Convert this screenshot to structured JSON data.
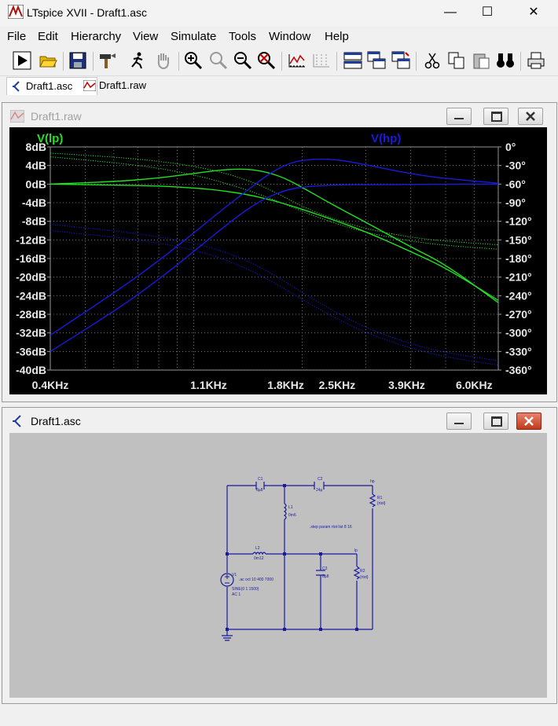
{
  "app": {
    "title": "LTspice XVII - Draft1.asc",
    "minimize": "—",
    "maximize": "☐",
    "close": "✕"
  },
  "menu": [
    "File",
    "Edit",
    "Hierarchy",
    "View",
    "Simulate",
    "Tools",
    "Window",
    "Help"
  ],
  "tabs": [
    {
      "label": "Draft1.asc",
      "icon": "schematic-icon",
      "active": true
    },
    {
      "label": "Draft1.raw",
      "icon": "waveform-icon",
      "active": false
    }
  ],
  "waveform_window": {
    "title": "Draft1.raw",
    "trace_labels": [
      {
        "name": "V(lp)",
        "color": "#22e022"
      },
      {
        "name": "V(hp)",
        "color": "#1a1adc"
      }
    ]
  },
  "schematic_window": {
    "title": "Draft1.asc",
    "components": {
      "C1": {
        "name": "C1",
        "value": "8µ8"
      },
      "C2": {
        "name": "C2",
        "value": "24µ"
      },
      "C3": {
        "name": "C3",
        "value": "8µ8"
      },
      "L1": {
        "name": "L1",
        "value": "0m6"
      },
      "L2": {
        "name": "L2",
        "value": "0m12"
      },
      "R1": {
        "name": "R1",
        "value": "{rtot}"
      },
      "R2": {
        "name": "R2",
        "value": "{rtot}"
      },
      "V1": {
        "name": "V1",
        "line2": "SINE(0 1 1500)",
        "line3": "AC 1"
      }
    },
    "net_labels": {
      "hp": "hp",
      "lp": "lp"
    },
    "directives": {
      "ac": ".ac oct 10 400 7000",
      "step": ".step param rtot list 8 16"
    }
  },
  "chart_data": {
    "type": "line",
    "title": "",
    "xlabel": "",
    "ylabel": "",
    "x_scale": "log",
    "x_ticks": [
      "0.4KHz",
      "1.1KHz",
      "1.8KHz",
      "2.5KHz",
      "3.9KHz",
      "6.0KHz"
    ],
    "y_ticks": [
      "8dB",
      "4dB",
      "0dB",
      "-4dB",
      "-8dB",
      "-12dB",
      "-16dB",
      "-20dB",
      "-24dB",
      "-28dB",
      "-32dB",
      "-36dB",
      "-40dB"
    ],
    "y2_ticks": [
      "0°",
      "-30°",
      "-60°",
      "-90°",
      "-120°",
      "-150°",
      "-180°",
      "-210°",
      "-240°",
      "-270°",
      "-300°",
      "-330°",
      "-360°"
    ],
    "xlim": [
      400,
      7000
    ],
    "ylim": [
      -40,
      8
    ],
    "y2lim": [
      -360,
      0
    ],
    "grid": true,
    "background": "#000000",
    "series": [
      {
        "name": "V(lp)",
        "kind": "magnitude",
        "style": "solid",
        "color": "#22e022",
        "x": [
          400,
          600,
          800,
          1000,
          1200,
          1400,
          1600,
          1800,
          2000,
          2400,
          3000,
          4000,
          5000,
          7000
        ],
        "y": [
          0,
          0.5,
          1.3,
          2.3,
          3.1,
          3.3,
          2.6,
          1.2,
          -0.7,
          -4.2,
          -8.2,
          -13.5,
          -17.3,
          -25.5
        ]
      },
      {
        "name": "V(lp)",
        "kind": "magnitude",
        "style": "solid",
        "color": "#22e022",
        "x": [
          400,
          600,
          800,
          1000,
          1200,
          1400,
          1600,
          1800,
          2000,
          2400,
          3000,
          4000,
          5000,
          7000
        ],
        "y": [
          0,
          -0.2,
          -0.4,
          -0.8,
          -1.4,
          -2.2,
          -3.2,
          -4.3,
          -5.4,
          -7.5,
          -10.2,
          -14.5,
          -18.0,
          -25.0
        ]
      },
      {
        "name": "V(lp)",
        "kind": "phase",
        "style": "dotted",
        "color": "#22e022",
        "x": [
          400,
          600,
          800,
          1000,
          1200,
          1400,
          1600,
          1800,
          2000,
          2400,
          3000,
          4000,
          5000,
          7000
        ],
        "y": [
          -10,
          -16,
          -23,
          -31,
          -41,
          -53,
          -67,
          -82,
          -96,
          -115,
          -132,
          -146,
          -152,
          -158
        ]
      },
      {
        "name": "V(lp)",
        "kind": "phase",
        "style": "dotted",
        "color": "#22e022",
        "x": [
          400,
          600,
          800,
          1000,
          1200,
          1400,
          1600,
          1800,
          2000,
          2400,
          3000,
          4000,
          5000,
          7000
        ],
        "y": [
          -16,
          -25,
          -34,
          -45,
          -57,
          -69,
          -81,
          -93,
          -104,
          -121,
          -138,
          -152,
          -159,
          -165
        ]
      },
      {
        "name": "V(hp)",
        "kind": "magnitude",
        "style": "solid",
        "color": "#1a1adc",
        "x": [
          400,
          600,
          800,
          1000,
          1200,
          1400,
          1600,
          1800,
          2000,
          2400,
          3000,
          4000,
          5000,
          7000
        ],
        "y": [
          -32.5,
          -23.5,
          -16.5,
          -10.5,
          -5.5,
          -1.5,
          2.0,
          4.2,
          5.2,
          5.5,
          4.2,
          2.2,
          1.2,
          0.2
        ]
      },
      {
        "name": "V(hp)",
        "kind": "magnitude",
        "style": "solid",
        "color": "#1a1adc",
        "x": [
          400,
          600,
          800,
          1000,
          1200,
          1400,
          1600,
          1800,
          2000,
          2400,
          3000,
          4000,
          5000,
          7000
        ],
        "y": [
          -36,
          -27.5,
          -20.5,
          -14.5,
          -9.5,
          -5.5,
          -2.8,
          -1.3,
          -0.6,
          -0.2,
          -0.1,
          -0.1,
          0,
          0
        ]
      },
      {
        "name": "V(hp)",
        "kind": "phase",
        "style": "dotted",
        "color": "#1a1adc",
        "x": [
          400,
          600,
          800,
          1000,
          1200,
          1400,
          1600,
          1800,
          2000,
          2400,
          3000,
          4000,
          5000,
          7000
        ],
        "y": [
          -125,
          -135,
          -145,
          -155,
          -168,
          -183,
          -200,
          -218,
          -235,
          -262,
          -292,
          -318,
          -332,
          -345
        ]
      },
      {
        "name": "V(hp)",
        "kind": "phase",
        "style": "dotted",
        "color": "#1a1adc",
        "x": [
          400,
          600,
          800,
          1000,
          1200,
          1400,
          1600,
          1800,
          2000,
          2400,
          3000,
          4000,
          5000,
          7000
        ],
        "y": [
          -135,
          -145,
          -155,
          -166,
          -180,
          -196,
          -213,
          -230,
          -246,
          -272,
          -300,
          -325,
          -339,
          -352
        ]
      }
    ]
  }
}
